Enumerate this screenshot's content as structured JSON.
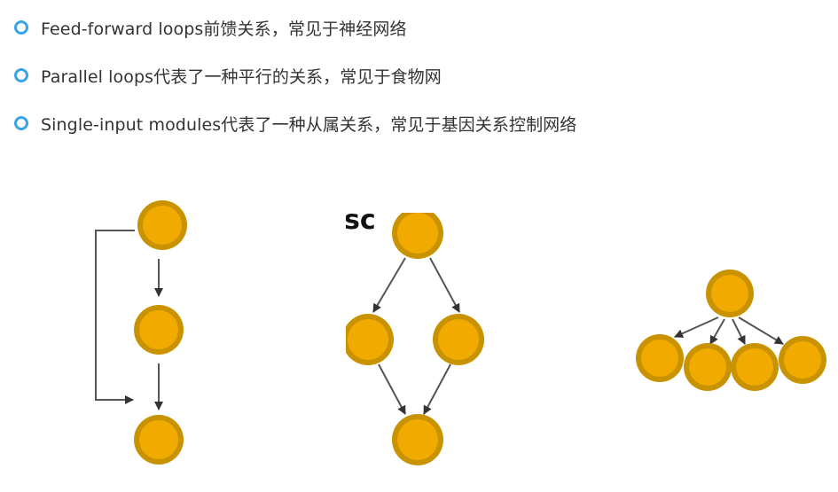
{
  "bullets": [
    {
      "text": "Feed-forward loops前馈关系，常见于神经网络"
    },
    {
      "text": "Parallel loops代表了一种平行的关系，常见于食物网"
    },
    {
      "text": "Single-input modules代表了一种从属关系，常见于基因关系控制网络"
    }
  ],
  "colors": {
    "bullet_ring": "#3aa4e6",
    "node_fill": "#f0aa00",
    "node_border": "#c99200",
    "edge": "#555555",
    "text": "#333333"
  },
  "diagrams": {
    "feed_forward": {
      "nodes": 3,
      "edges": 3
    },
    "parallel": {
      "nodes": 4,
      "edges": 4,
      "clipped_text": "sc"
    },
    "single_input": {
      "nodes": 5,
      "edges": 4
    }
  }
}
